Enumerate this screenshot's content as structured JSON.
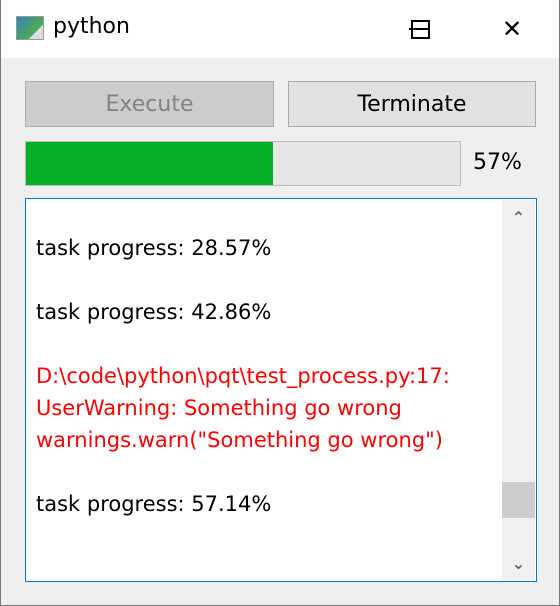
{
  "window": {
    "title": "python",
    "close": "✕"
  },
  "toolbar": {
    "execute_label": "Execute",
    "terminate_label": "Terminate"
  },
  "progress": {
    "value": 57,
    "label": "57%",
    "color": "#06b025"
  },
  "log": {
    "lines": [
      {
        "text": "",
        "color": "#000000"
      },
      {
        "text": "task progress: 28.57%",
        "color": "#000000"
      },
      {
        "text": "",
        "color": "#000000"
      },
      {
        "text": "task progress: 42.86%",
        "color": "#000000"
      },
      {
        "text": "",
        "color": "#000000"
      },
      {
        "text": "D:\\code\\python\\pqt\\test_process.py:17:",
        "color": "#ff0000"
      },
      {
        "text": "UserWarning: Something go wrong",
        "color": "#ff0000"
      },
      {
        "text": "warnings.warn(\"Something go wrong\")",
        "color": "#ff0000"
      },
      {
        "text": "",
        "color": "#000000"
      },
      {
        "text": "task progress: 57.14%",
        "color": "#000000"
      }
    ],
    "scroll_up": "⌃",
    "scroll_down": "⌄",
    "scroll_position": 0.9
  }
}
